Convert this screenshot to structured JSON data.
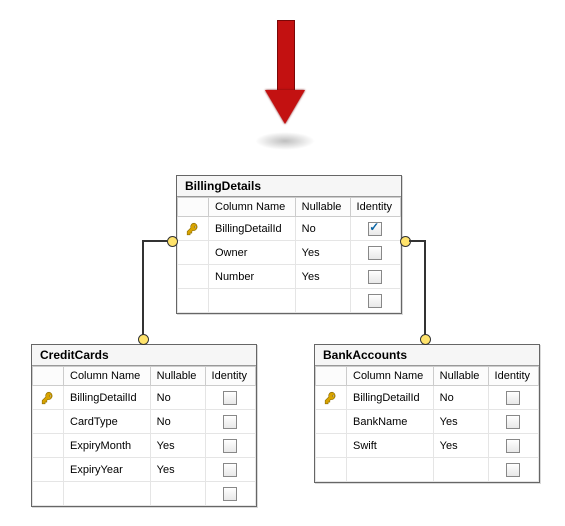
{
  "headers": {
    "col": "Column Name",
    "null": "Nullable",
    "id": "Identity"
  },
  "entities": {
    "billing": {
      "title": "BillingDetails",
      "rows": [
        {
          "pk": true,
          "name": "BillingDetailId",
          "nullable": "No",
          "identity": true
        },
        {
          "pk": false,
          "name": "Owner",
          "nullable": "Yes",
          "identity": false
        },
        {
          "pk": false,
          "name": "Number",
          "nullable": "Yes",
          "identity": false
        }
      ]
    },
    "credit": {
      "title": "CreditCards",
      "rows": [
        {
          "pk": true,
          "name": "BillingDetailId",
          "nullable": "No",
          "identity": false
        },
        {
          "pk": false,
          "name": "CardType",
          "nullable": "No",
          "identity": false
        },
        {
          "pk": false,
          "name": "ExpiryMonth",
          "nullable": "Yes",
          "identity": false
        },
        {
          "pk": false,
          "name": "ExpiryYear",
          "nullable": "Yes",
          "identity": false
        }
      ]
    },
    "bank": {
      "title": "BankAccounts",
      "rows": [
        {
          "pk": true,
          "name": "BillingDetailId",
          "nullable": "No",
          "identity": false
        },
        {
          "pk": false,
          "name": "BankName",
          "nullable": "Yes",
          "identity": false
        },
        {
          "pk": false,
          "name": "Swift",
          "nullable": "Yes",
          "identity": false
        }
      ]
    }
  }
}
